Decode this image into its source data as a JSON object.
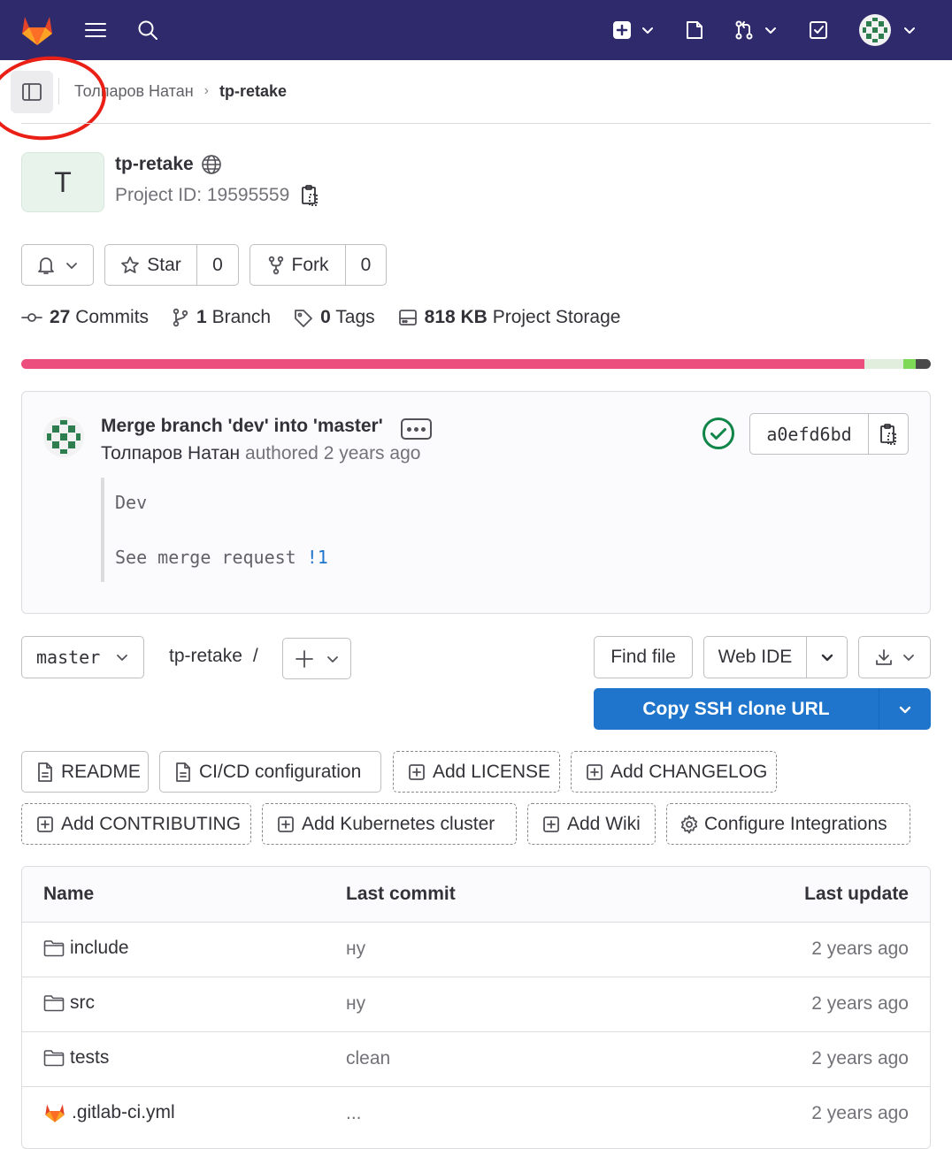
{
  "topbar": {
    "logo": "gitlab-tanuki-icon",
    "icons": [
      "menu-icon",
      "search-icon",
      "new-item-icon",
      "issues-icon",
      "merge-requests-icon",
      "todo-icon",
      "user-avatar"
    ]
  },
  "breadcrumb": {
    "owner": "Толпаров Натан",
    "project": "tp-retake"
  },
  "project": {
    "avatar_letter": "T",
    "name": "tp-retake",
    "id_text": "Project ID: 19595559",
    "visibility_icon": "globe-icon"
  },
  "actions": {
    "star_label": "Star",
    "star_count": "0",
    "fork_label": "Fork",
    "fork_count": "0"
  },
  "stats": {
    "commits_count": "27",
    "commits_label": "Commits",
    "branch_count": "1",
    "branch_label": "Branch",
    "tags_count": "0",
    "tags_label": "Tags",
    "storage_size": "818 KB",
    "storage_label": "Project Storage"
  },
  "languages": [
    {
      "fraction": 0.927,
      "color": "#ec4f7d"
    },
    {
      "fraction": 0.043,
      "color": "#e2eedd"
    },
    {
      "fraction": 0.013,
      "color": "#7ed957"
    },
    {
      "fraction": 0.017,
      "color": "#4a4a4a"
    }
  ],
  "last_commit": {
    "title": "Merge branch 'dev' into 'master'",
    "author": "Толпаров Натан",
    "authored_text": "authored 2 years ago",
    "description_line1": "Dev",
    "description_line2": "See merge request",
    "mr_link": "!1",
    "sha": "a0efd6bd",
    "status": "success"
  },
  "repo": {
    "branch": "master",
    "path": "tp-retake",
    "path_sep": "/",
    "find_file": "Find file",
    "web_ide": "Web IDE",
    "clone_label": "Copy SSH clone URL"
  },
  "shortcuts": {
    "readme": "README",
    "cicd": "CI/CD configuration",
    "add_license": "Add LICENSE",
    "add_changelog": "Add CHANGELOG",
    "add_contributing": "Add CONTRIBUTING",
    "add_k8s": "Add Kubernetes cluster",
    "add_wiki": "Add Wiki",
    "configure_integrations": "Configure Integrations"
  },
  "table": {
    "headers": {
      "name": "Name",
      "last_commit": "Last commit",
      "last_update": "Last update"
    },
    "rows": [
      {
        "name": "include",
        "type": "folder",
        "commit": "ну",
        "updated": "2 years ago"
      },
      {
        "name": "src",
        "type": "folder",
        "commit": "ну",
        "updated": "2 years ago"
      },
      {
        "name": "tests",
        "type": "folder",
        "commit": "clean",
        "updated": "2 years ago"
      },
      {
        "name": ".gitlab-ci.yml",
        "type": "gitlab-file",
        "commit": "...",
        "updated": "2 years ago"
      }
    ]
  }
}
